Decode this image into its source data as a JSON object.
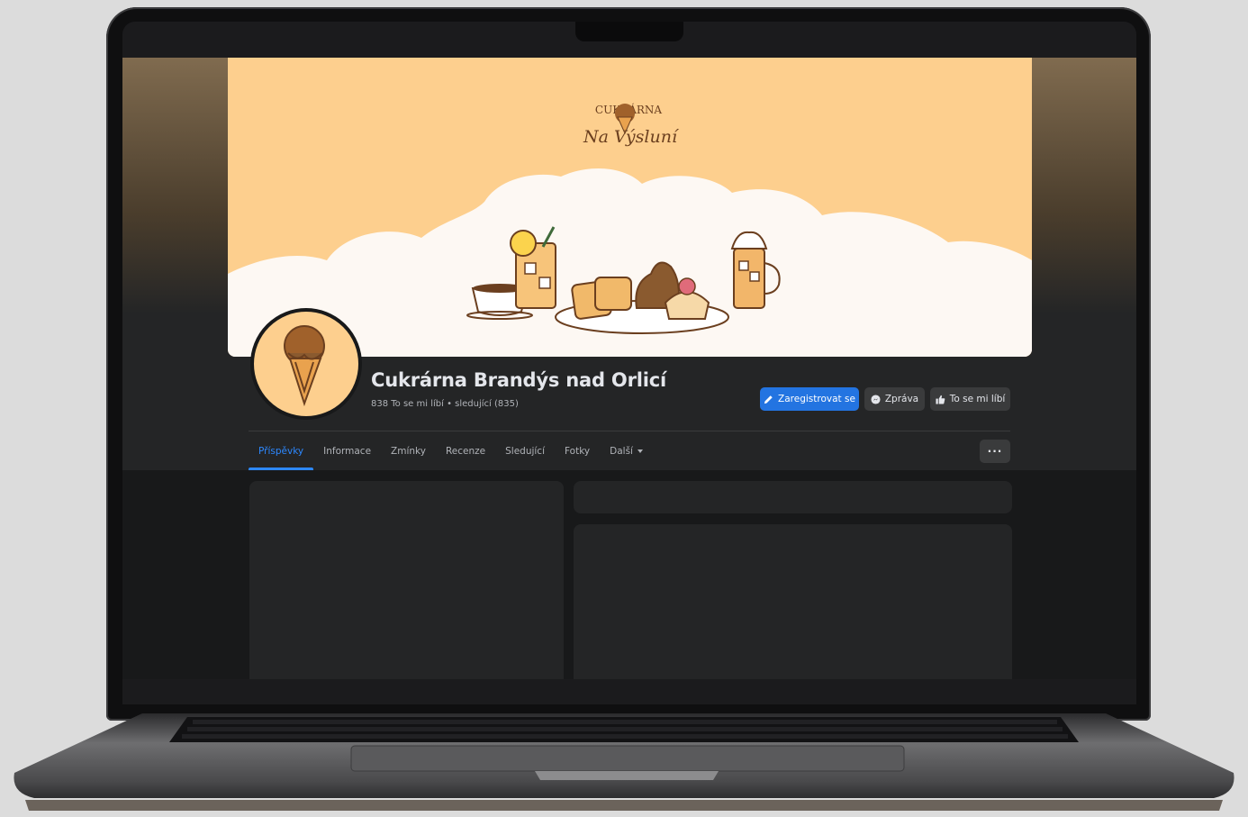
{
  "cover": {
    "logo_top": "CUKRÁRNA",
    "logo_bottom": "Na Výsluní"
  },
  "page": {
    "name": "Cukrárna Brandýs nad Orlicí",
    "stats": "838 To se mi líbí • sledující (835)"
  },
  "actions": {
    "register": "Zaregistrovat se",
    "message": "Zpráva",
    "like": "To se mi líbí",
    "more": "···"
  },
  "tabs": [
    "Příspěvky",
    "Informace",
    "Zmínky",
    "Recenze",
    "Sledující",
    "Fotky",
    "Další"
  ],
  "colors": {
    "accent": "#2374e1",
    "cover_bg": "#fdcf8e",
    "surface": "#242526"
  }
}
